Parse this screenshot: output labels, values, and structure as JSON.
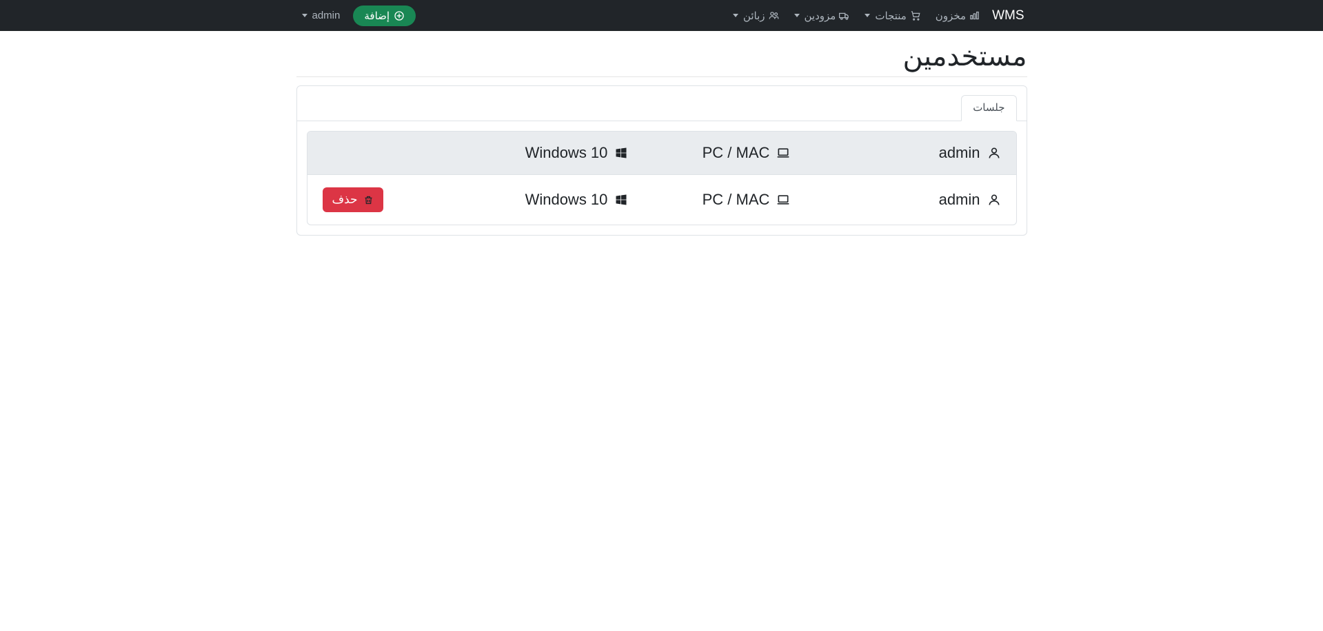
{
  "brand": "WMS",
  "nav": {
    "items": [
      {
        "label": "مخزون"
      },
      {
        "label": "منتجات"
      },
      {
        "label": "مزودين"
      },
      {
        "label": "زبائن"
      }
    ],
    "add_label": "إضافة",
    "user_label": "admin"
  },
  "page": {
    "title": "مستخدمين",
    "tab_sessions": "جلسات"
  },
  "sessions": [
    {
      "user": "admin",
      "device": "PC / MAC",
      "os": "Windows 10",
      "current": true
    },
    {
      "user": "admin",
      "device": "PC / MAC",
      "os": "Windows 10",
      "current": false
    }
  ],
  "actions": {
    "delete_label": "حذف"
  },
  "colors": {
    "navbar": "#212529",
    "accent_green": "#198754",
    "danger_red": "#dc3545"
  }
}
